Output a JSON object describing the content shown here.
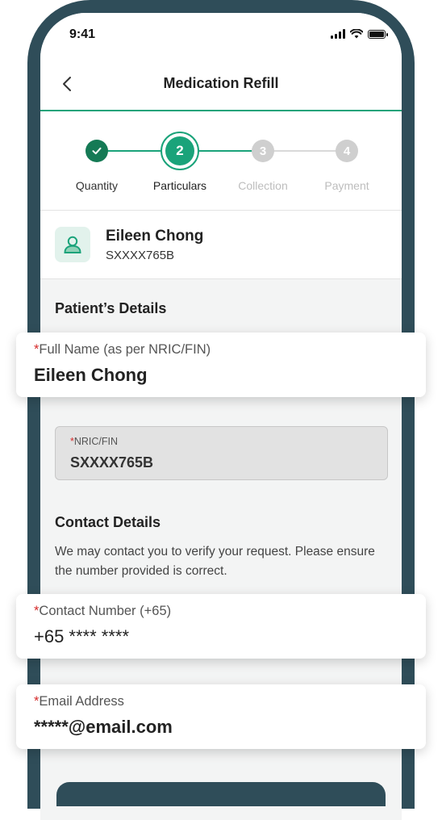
{
  "status_bar": {
    "time": "9:41"
  },
  "header": {
    "title": "Medication Refill"
  },
  "steps": [
    {
      "number": "1",
      "label": "Quantity",
      "state": "done"
    },
    {
      "number": "2",
      "label": "Particulars",
      "state": "current"
    },
    {
      "number": "3",
      "label": "Collection",
      "state": "pending"
    },
    {
      "number": "4",
      "label": "Payment",
      "state": "pending"
    }
  ],
  "profile": {
    "name": "Eileen Chong",
    "id": "SXXXX765B"
  },
  "patient_section": {
    "title": "Patient’s Details"
  },
  "fields": {
    "full_name": {
      "required_mark": "*",
      "label": "Full Name (as per NRIC/FIN)",
      "value": "Eileen Chong"
    },
    "nric": {
      "required_mark": "*",
      "label": "NRIC/FIN",
      "value": "SXXXX765B"
    },
    "contact": {
      "required_mark": "*",
      "label": "Contact Number (+65)",
      "value": "+65 **** ****"
    },
    "email": {
      "required_mark": "*",
      "label": "Email Address",
      "value": "*****@email.com"
    }
  },
  "contact_section": {
    "title": "Contact Details",
    "description": "We may contact you to verify your request. Please ensure the number provided is correct."
  },
  "colors": {
    "frame": "#2f4d59",
    "accent_green": "#1aa37a",
    "done_green": "#157a55",
    "pending_gray": "#cfcfcf",
    "required_red": "#d62b2b"
  }
}
